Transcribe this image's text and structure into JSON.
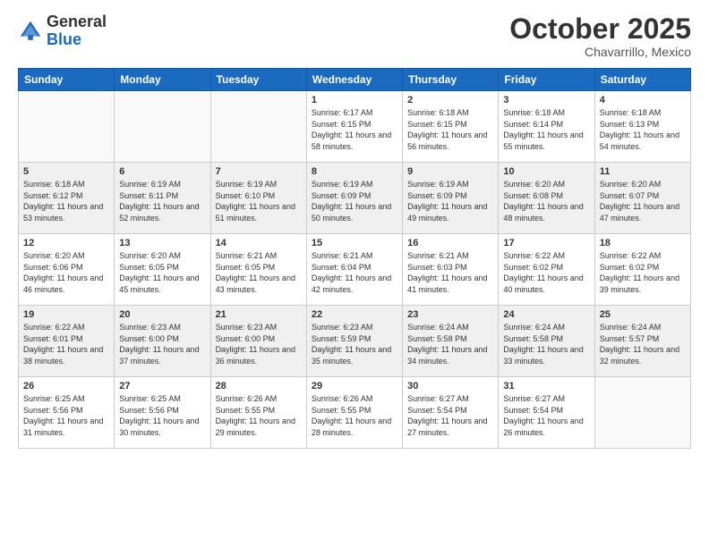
{
  "logo": {
    "line1": "General",
    "line2": "Blue"
  },
  "header": {
    "month": "October 2025",
    "location": "Chavarrillo, Mexico"
  },
  "weekdays": [
    "Sunday",
    "Monday",
    "Tuesday",
    "Wednesday",
    "Thursday",
    "Friday",
    "Saturday"
  ],
  "weeks": [
    [
      {
        "day": "",
        "sunrise": "",
        "sunset": "",
        "daylight": ""
      },
      {
        "day": "",
        "sunrise": "",
        "sunset": "",
        "daylight": ""
      },
      {
        "day": "",
        "sunrise": "",
        "sunset": "",
        "daylight": ""
      },
      {
        "day": "1",
        "sunrise": "Sunrise: 6:17 AM",
        "sunset": "Sunset: 6:15 PM",
        "daylight": "Daylight: 11 hours and 58 minutes."
      },
      {
        "day": "2",
        "sunrise": "Sunrise: 6:18 AM",
        "sunset": "Sunset: 6:15 PM",
        "daylight": "Daylight: 11 hours and 56 minutes."
      },
      {
        "day": "3",
        "sunrise": "Sunrise: 6:18 AM",
        "sunset": "Sunset: 6:14 PM",
        "daylight": "Daylight: 11 hours and 55 minutes."
      },
      {
        "day": "4",
        "sunrise": "Sunrise: 6:18 AM",
        "sunset": "Sunset: 6:13 PM",
        "daylight": "Daylight: 11 hours and 54 minutes."
      }
    ],
    [
      {
        "day": "5",
        "sunrise": "Sunrise: 6:18 AM",
        "sunset": "Sunset: 6:12 PM",
        "daylight": "Daylight: 11 hours and 53 minutes."
      },
      {
        "day": "6",
        "sunrise": "Sunrise: 6:19 AM",
        "sunset": "Sunset: 6:11 PM",
        "daylight": "Daylight: 11 hours and 52 minutes."
      },
      {
        "day": "7",
        "sunrise": "Sunrise: 6:19 AM",
        "sunset": "Sunset: 6:10 PM",
        "daylight": "Daylight: 11 hours and 51 minutes."
      },
      {
        "day": "8",
        "sunrise": "Sunrise: 6:19 AM",
        "sunset": "Sunset: 6:09 PM",
        "daylight": "Daylight: 11 hours and 50 minutes."
      },
      {
        "day": "9",
        "sunrise": "Sunrise: 6:19 AM",
        "sunset": "Sunset: 6:09 PM",
        "daylight": "Daylight: 11 hours and 49 minutes."
      },
      {
        "day": "10",
        "sunrise": "Sunrise: 6:20 AM",
        "sunset": "Sunset: 6:08 PM",
        "daylight": "Daylight: 11 hours and 48 minutes."
      },
      {
        "day": "11",
        "sunrise": "Sunrise: 6:20 AM",
        "sunset": "Sunset: 6:07 PM",
        "daylight": "Daylight: 11 hours and 47 minutes."
      }
    ],
    [
      {
        "day": "12",
        "sunrise": "Sunrise: 6:20 AM",
        "sunset": "Sunset: 6:06 PM",
        "daylight": "Daylight: 11 hours and 46 minutes."
      },
      {
        "day": "13",
        "sunrise": "Sunrise: 6:20 AM",
        "sunset": "Sunset: 6:05 PM",
        "daylight": "Daylight: 11 hours and 45 minutes."
      },
      {
        "day": "14",
        "sunrise": "Sunrise: 6:21 AM",
        "sunset": "Sunset: 6:05 PM",
        "daylight": "Daylight: 11 hours and 43 minutes."
      },
      {
        "day": "15",
        "sunrise": "Sunrise: 6:21 AM",
        "sunset": "Sunset: 6:04 PM",
        "daylight": "Daylight: 11 hours and 42 minutes."
      },
      {
        "day": "16",
        "sunrise": "Sunrise: 6:21 AM",
        "sunset": "Sunset: 6:03 PM",
        "daylight": "Daylight: 11 hours and 41 minutes."
      },
      {
        "day": "17",
        "sunrise": "Sunrise: 6:22 AM",
        "sunset": "Sunset: 6:02 PM",
        "daylight": "Daylight: 11 hours and 40 minutes."
      },
      {
        "day": "18",
        "sunrise": "Sunrise: 6:22 AM",
        "sunset": "Sunset: 6:02 PM",
        "daylight": "Daylight: 11 hours and 39 minutes."
      }
    ],
    [
      {
        "day": "19",
        "sunrise": "Sunrise: 6:22 AM",
        "sunset": "Sunset: 6:01 PM",
        "daylight": "Daylight: 11 hours and 38 minutes."
      },
      {
        "day": "20",
        "sunrise": "Sunrise: 6:23 AM",
        "sunset": "Sunset: 6:00 PM",
        "daylight": "Daylight: 11 hours and 37 minutes."
      },
      {
        "day": "21",
        "sunrise": "Sunrise: 6:23 AM",
        "sunset": "Sunset: 6:00 PM",
        "daylight": "Daylight: 11 hours and 36 minutes."
      },
      {
        "day": "22",
        "sunrise": "Sunrise: 6:23 AM",
        "sunset": "Sunset: 5:59 PM",
        "daylight": "Daylight: 11 hours and 35 minutes."
      },
      {
        "day": "23",
        "sunrise": "Sunrise: 6:24 AM",
        "sunset": "Sunset: 5:58 PM",
        "daylight": "Daylight: 11 hours and 34 minutes."
      },
      {
        "day": "24",
        "sunrise": "Sunrise: 6:24 AM",
        "sunset": "Sunset: 5:58 PM",
        "daylight": "Daylight: 11 hours and 33 minutes."
      },
      {
        "day": "25",
        "sunrise": "Sunrise: 6:24 AM",
        "sunset": "Sunset: 5:57 PM",
        "daylight": "Daylight: 11 hours and 32 minutes."
      }
    ],
    [
      {
        "day": "26",
        "sunrise": "Sunrise: 6:25 AM",
        "sunset": "Sunset: 5:56 PM",
        "daylight": "Daylight: 11 hours and 31 minutes."
      },
      {
        "day": "27",
        "sunrise": "Sunrise: 6:25 AM",
        "sunset": "Sunset: 5:56 PM",
        "daylight": "Daylight: 11 hours and 30 minutes."
      },
      {
        "day": "28",
        "sunrise": "Sunrise: 6:26 AM",
        "sunset": "Sunset: 5:55 PM",
        "daylight": "Daylight: 11 hours and 29 minutes."
      },
      {
        "day": "29",
        "sunrise": "Sunrise: 6:26 AM",
        "sunset": "Sunset: 5:55 PM",
        "daylight": "Daylight: 11 hours and 28 minutes."
      },
      {
        "day": "30",
        "sunrise": "Sunrise: 6:27 AM",
        "sunset": "Sunset: 5:54 PM",
        "daylight": "Daylight: 11 hours and 27 minutes."
      },
      {
        "day": "31",
        "sunrise": "Sunrise: 6:27 AM",
        "sunset": "Sunset: 5:54 PM",
        "daylight": "Daylight: 11 hours and 26 minutes."
      },
      {
        "day": "",
        "sunrise": "",
        "sunset": "",
        "daylight": ""
      }
    ]
  ]
}
